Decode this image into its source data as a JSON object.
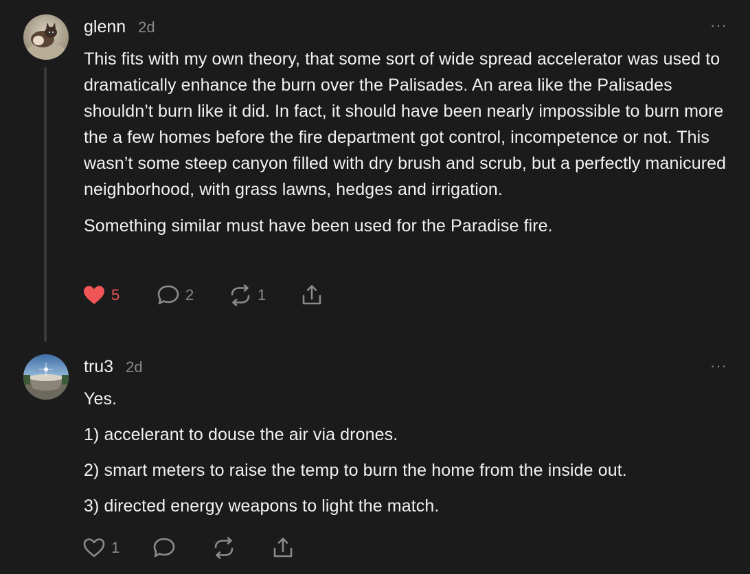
{
  "comments": [
    {
      "author": "glenn",
      "time": "2d",
      "more": "···",
      "paragraphs": [
        "This fits with my own theory, that some sort of wide spread accelerator was used to dramatically enhance the burn over the Palisades. An area like the Palisades shouldn’t burn like it did. In fact, it should have been nearly impossible to burn more the a few homes before the fire department got control, incompetence or not. This wasn’t some steep canyon filled with dry brush and scrub, but a perfectly manicured neighborhood, with grass lawns, hedges and irrigation.",
        "Something similar must have been used for the Paradise fire."
      ],
      "actions": {
        "likes": "5",
        "liked": true,
        "replies": "2",
        "restacks": "1"
      },
      "icons": {
        "like": "heart-filled-icon",
        "reply": "speech-bubble-icon",
        "restack": "restack-icon",
        "share": "share-icon",
        "more": "ellipsis-icon"
      },
      "colors": {
        "liked": "#f05656"
      }
    },
    {
      "author": "tru3",
      "time": "2d",
      "more": "···",
      "paragraphs": [
        "Yes.",
        "1) accelerant to douse the air via drones.",
        "2) smart meters to raise the temp to burn the home from the inside out.",
        "3) directed energy weapons to light the match."
      ],
      "actions": {
        "likes": "1",
        "liked": false
      },
      "icons": {
        "like": "heart-outline-icon",
        "reply": "speech-bubble-icon",
        "restack": "restack-icon",
        "share": "share-icon",
        "more": "ellipsis-icon"
      }
    }
  ],
  "theme": {
    "background": "#1b1b1c",
    "text": "#f2f2f2",
    "muted": "#8b8b8f"
  }
}
